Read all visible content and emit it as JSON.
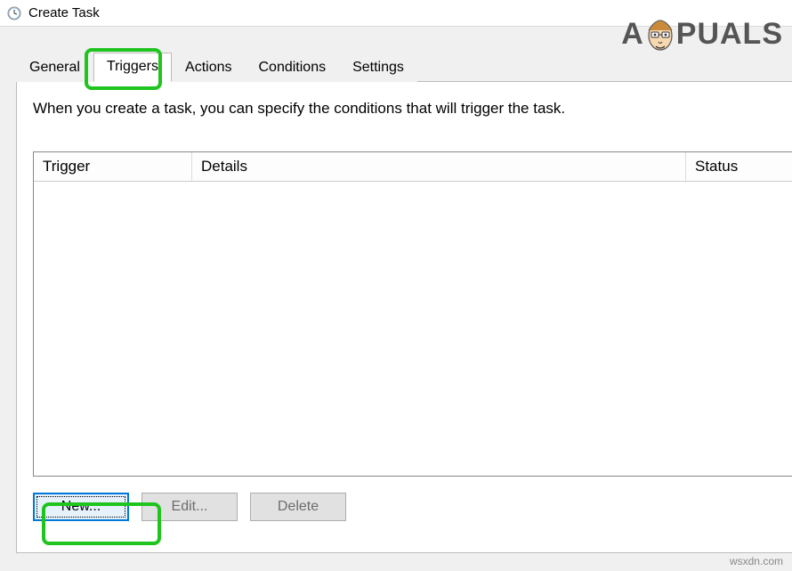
{
  "window": {
    "title": "Create Task"
  },
  "tabs": {
    "general": "General",
    "triggers": "Triggers",
    "actions": "Actions",
    "conditions": "Conditions",
    "settings": "Settings",
    "active": "triggers"
  },
  "panel": {
    "description": "When you create a task, you can specify the conditions that will trigger the task.",
    "columns": {
      "trigger": "Trigger",
      "details": "Details",
      "status": "Status"
    }
  },
  "buttons": {
    "new": "New...",
    "edit": "Edit...",
    "delete": "Delete"
  },
  "watermark": {
    "prefix": "A",
    "suffix": "PUALS"
  },
  "footer": "wsxdn.com"
}
